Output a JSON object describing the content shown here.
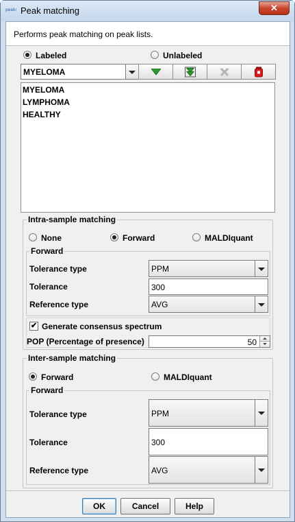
{
  "window": {
    "title": "Peak matching",
    "app_icon_text": "peaks",
    "close_label": "✕"
  },
  "description": "Performs peak matching on peak lists.",
  "labels_section": {
    "labeled_label": "Labeled",
    "unlabeled_label": "Unlabeled",
    "labeled_selected": true,
    "combo_value": "MYELOMA",
    "toolbar_icons": [
      "add-icon",
      "add-all-icon",
      "remove-icon",
      "clear-all-icon"
    ],
    "list_items": [
      "MYELOMA",
      "LYMPHOMA",
      "HEALTHY"
    ]
  },
  "intra": {
    "title": "Intra-sample matching",
    "options": [
      "None",
      "Forward",
      "MALDIquant"
    ],
    "selected": "Forward",
    "forward_title": "Forward",
    "tolerance_type_label": "Tolerance type",
    "tolerance_type_value": "PPM",
    "tolerance_label": "Tolerance",
    "tolerance_value": "300",
    "reference_type_label": "Reference type",
    "reference_type_value": "AVG",
    "consensus_label": "Generate consensus spectrum",
    "consensus_checked": "✔",
    "pop_label": "POP (Percentage of presence)",
    "pop_value": "50"
  },
  "inter": {
    "title": "Inter-sample matching",
    "options": [
      "Forward",
      "MALDIquant"
    ],
    "selected": "Forward",
    "forward_title": "Forward",
    "tolerance_type_label": "Tolerance type",
    "tolerance_type_value": "PPM",
    "tolerance_label": "Tolerance",
    "tolerance_value": "300",
    "reference_type_label": "Reference type",
    "reference_type_value": "AVG"
  },
  "buttons": {
    "ok": "OK",
    "cancel": "Cancel",
    "help": "Help"
  },
  "colors": {
    "accent_green": "#2e9a2e",
    "delete_red": "#d81c1c",
    "disabled_grey": "#b5b5b5"
  }
}
